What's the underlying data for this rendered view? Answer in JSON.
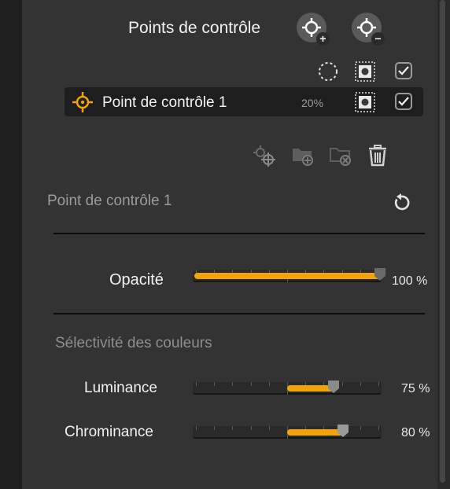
{
  "header": {
    "title": "Points de contrôle"
  },
  "buttons": {
    "add_point": "+",
    "remove_point": "−"
  },
  "control_point": {
    "name": "Point de contrôle 1",
    "opacity_value": "20%"
  },
  "section": {
    "title": "Point de contrôle 1"
  },
  "opacity": {
    "label": "Opacité",
    "value": 100,
    "value_text": "100 %"
  },
  "color_selectivity": {
    "title": "Sélectivité des couleurs",
    "luminance": {
      "label": "Luminance",
      "min": 15,
      "max": 75,
      "value": 75,
      "value_text": "75 %"
    },
    "chrominance": {
      "label": "Chrominance",
      "min": 15,
      "max": 80,
      "value": 80,
      "value_text": "80 %"
    }
  },
  "colors": {
    "accent": "#f0a30a",
    "panel": "#333333",
    "row_bg": "#1e1e1e"
  }
}
